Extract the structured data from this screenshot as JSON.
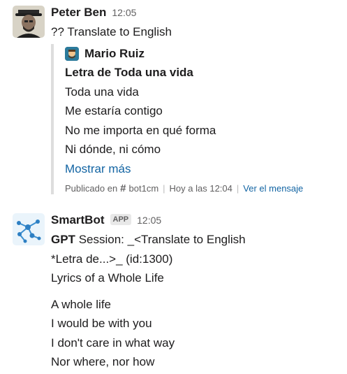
{
  "messages": [
    {
      "author": "Peter Ben",
      "time": "12:05",
      "text": "?? Translate to English",
      "quote": {
        "author": "Mario Ruiz",
        "title": "Letra de Toda una vida",
        "lines": [
          "Toda una vida",
          "Me estaría contigo",
          "No me importa en qué forma",
          "Ni dónde, ni cómo"
        ],
        "more_label": "Mostrar más",
        "footer": {
          "posted_in": "Publicado en",
          "channel": "bot1cm",
          "when": "Hoy a las 12:04",
          "view_label": "Ver el mensaje"
        }
      }
    },
    {
      "author": "SmartBot",
      "badge": "APP",
      "time": "12:05",
      "lines": [
        "GPT Session: _<Translate to English",
        "*Letra de...>_ (id:1300)",
        "Lyrics of a Whole Life"
      ],
      "lines2": [
        "A whole life",
        "I would be with you",
        "I don't care in what way",
        "Nor where, nor how"
      ]
    }
  ],
  "colors": {
    "link": "#1264a3",
    "quote_bar": "#dddddd",
    "muted": "#616061"
  }
}
